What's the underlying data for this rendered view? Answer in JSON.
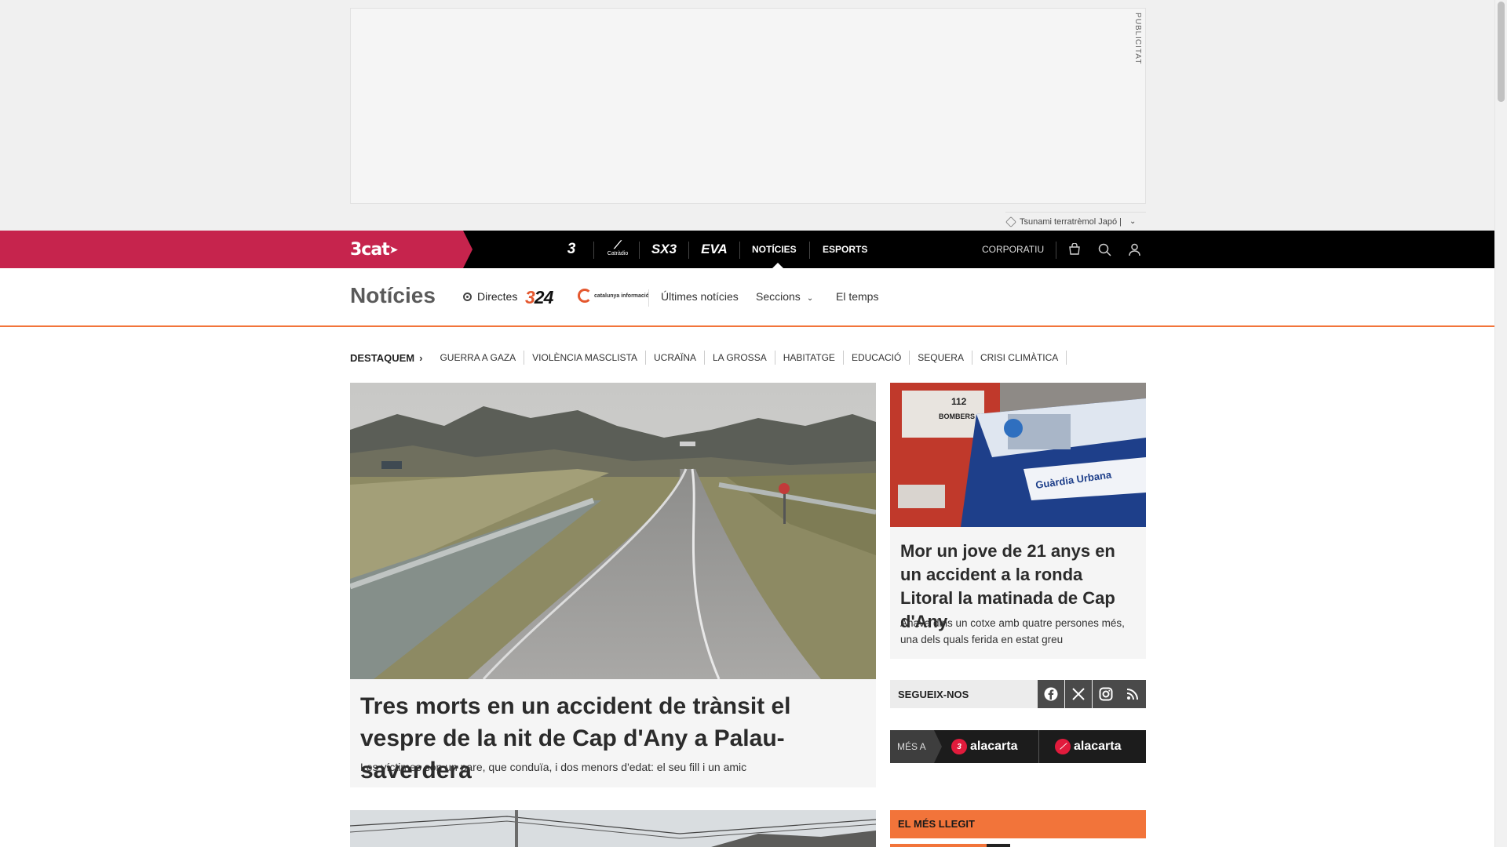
{
  "ad": {
    "label": "PUBLICITAT",
    "trending": "Tsunami terratrèmol Japó |"
  },
  "topnav": {
    "brand": "3cat",
    "channels": [
      "3",
      "Cat",
      "SX3",
      "EVA"
    ],
    "channel_sub": "Catràdio",
    "links": {
      "noticies": "NOTÍCIES",
      "esports": "ESPORTS",
      "corporatiu": "CORPORATIU"
    },
    "icons": [
      "shop-icon",
      "search-icon",
      "user-icon"
    ]
  },
  "section": {
    "title": "Notícies",
    "directes": "Directes",
    "logo_324_a": "3",
    "logo_324_b": "24",
    "logo_catinfo": "catalunya informació",
    "links": {
      "ultimes": "Últimes notícies",
      "seccions": "Seccions",
      "temps": "El temps"
    }
  },
  "destaquem": {
    "label": "DESTAQUEM",
    "items": [
      "GUERRA A GAZA",
      "VIOLÈNCIA MASCLISTA",
      "UCRAÏNA",
      "LA GROSSA",
      "HABITATGE",
      "EDUCACIÓ",
      "SEQUERA",
      "CRISI CLIMÀTICA"
    ]
  },
  "main_article": {
    "title": "Tres morts en un accident de trànsit el vespre de la nit de Cap d'Any a Palau-saverdera",
    "subtitle": "Les víctimes són un pare, que conduïa, i dos menors d'edat: el seu fill i un amic"
  },
  "side_article": {
    "title": "Mor un jove de 21 anys en un accident a la ronda Litoral la matinada de Cap d'Any",
    "subtitle": "Anava dins un cotxe amb quatre persones més, una dels quals ferida en estat greu",
    "image_text_1": "112",
    "image_text_2": "BOMBERS",
    "image_text_3": "Guàrdia Urbana"
  },
  "follow": {
    "label": "SEGUEIX-NOS",
    "networks": [
      "facebook-icon",
      "x-icon",
      "instagram-icon",
      "rss-icon"
    ]
  },
  "mes_a": {
    "label": "MÉS A",
    "logo1": "alacarta",
    "logo2": "alacarta"
  },
  "mes_llegit": {
    "label": "EL MÉS LLEGIT"
  },
  "colors": {
    "brand": "#c6244d",
    "accent_orange": "#f2743a",
    "nav_bg": "#000000"
  }
}
